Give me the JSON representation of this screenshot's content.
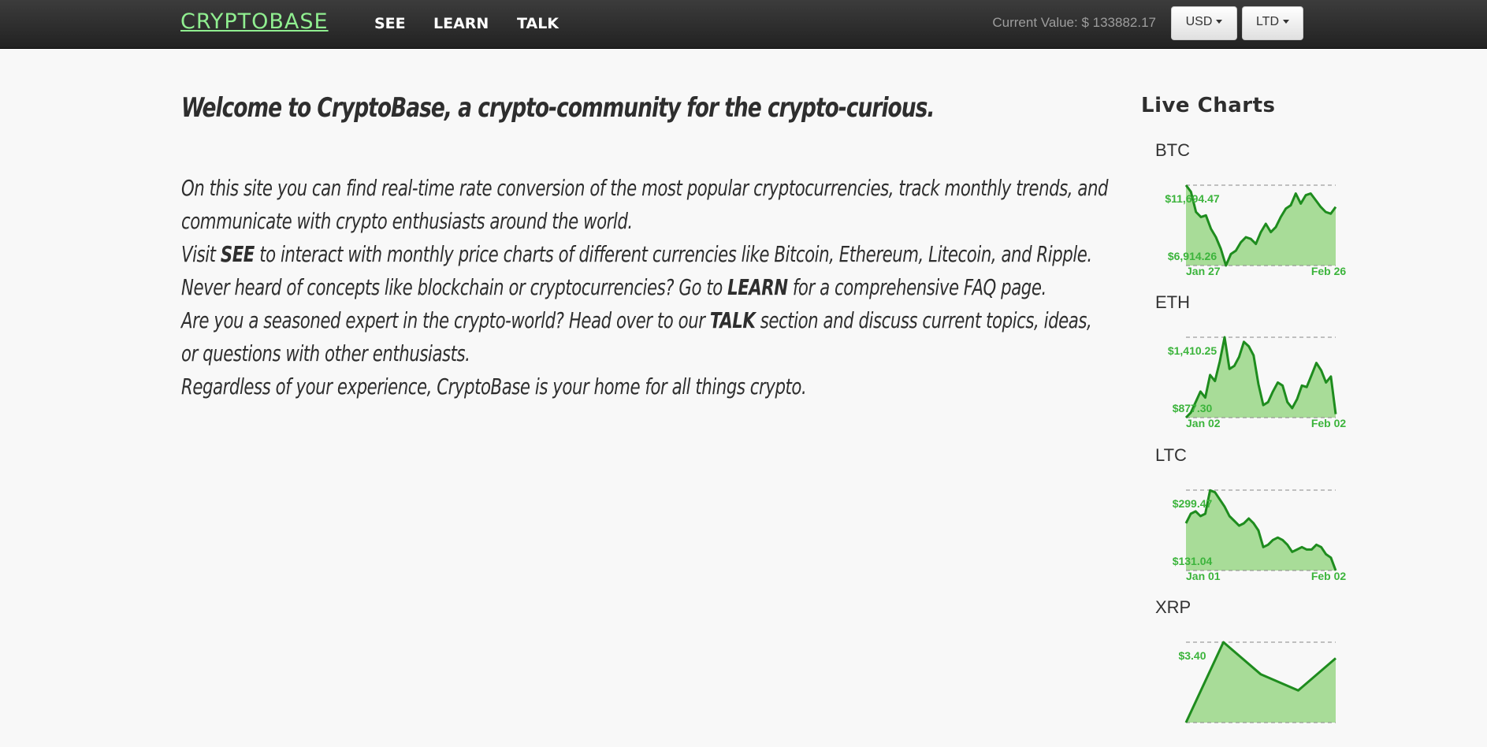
{
  "nav": {
    "brand": "CRYPTOBASE",
    "links": [
      "SEE",
      "LEARN",
      "TALK"
    ],
    "current_value": "Current Value: $ 133882.17",
    "currency_dropdown": "USD",
    "coin_dropdown": "LTD"
  },
  "main": {
    "title": "Welcome to CryptoBase, a crypto-community for the crypto-curious.",
    "p1": "On this site you can find real-time rate conversion of the most popular cryptocurrencies, track monthly trends, and communicate with crypto enthusiasts around the world.",
    "p2_before": "Visit ",
    "p2_bold": "SEE",
    "p2_after": " to interact with monthly price charts of different currencies like Bitcoin, Ethereum, Litecoin, and Ripple.",
    "p3_before": "Never heard of concepts like blockchain or cryptocurrencies? Go to ",
    "p3_bold": "LEARN",
    "p3_after": " for a comprehensive FAQ page.",
    "p4_before": "Are you a seasoned expert in the crypto-world? Head over to our ",
    "p4_bold": "TALK",
    "p4_after": " section and discuss current topics, ideas, or questions with other enthusiasts.",
    "p5": "Regardless of your experience, CryptoBase is your home for all things crypto."
  },
  "sidebar": {
    "title": "Live Charts"
  },
  "colors": {
    "line": "#1e8c1e",
    "area": "#a8dc98",
    "label": "#3cb43c",
    "brand": "#90ee90"
  },
  "chart_data": [
    {
      "type": "area",
      "title": "BTC",
      "max_label": "$11,694.47",
      "min_label": "$6,914.26",
      "x_start": "Jan 27",
      "x_end": "Feb 26",
      "ylim": [
        6914.26,
        11694.47
      ],
      "values": [
        11694,
        11300,
        10100,
        9800,
        9900,
        9100,
        8600,
        7900,
        6914,
        7600,
        7800,
        8300,
        8600,
        8500,
        8200,
        8900,
        9400,
        8900,
        9200,
        9800,
        10300,
        10500,
        11200,
        10600,
        11100,
        11200,
        10800,
        10400,
        10100,
        10000,
        10400
      ]
    },
    {
      "type": "area",
      "title": "ETH",
      "max_label": "$1,410.25",
      "min_label": "$877.30",
      "x_start": "Jan 02",
      "x_end": "Feb 02",
      "ylim": [
        877.3,
        1410.25
      ],
      "values": [
        877,
        910,
        980,
        1050,
        1010,
        1160,
        1120,
        1250,
        1410,
        1200,
        1220,
        1280,
        1380,
        1350,
        1290,
        1100,
        960,
        980,
        1050,
        1110,
        1090,
        980,
        940,
        1000,
        1090,
        1080,
        1160,
        1240,
        1190,
        1110,
        1150,
        900
      ]
    },
    {
      "type": "area",
      "title": "LTC",
      "max_label": "$299.47",
      "min_label": "$131.04",
      "x_start": "Jan 01",
      "x_end": "Feb 02",
      "ylim": [
        131.04,
        299.47
      ],
      "values": [
        230,
        250,
        255,
        245,
        250,
        299,
        295,
        280,
        265,
        245,
        235,
        225,
        230,
        240,
        230,
        215,
        180,
        185,
        195,
        200,
        195,
        185,
        170,
        175,
        180,
        175,
        175,
        185,
        180,
        165,
        158,
        131
      ]
    },
    {
      "type": "area",
      "title": "XRP",
      "max_label": "$3.40",
      "values": [
        2.9,
        3.4,
        3.2,
        3.1,
        3.3
      ]
    }
  ]
}
